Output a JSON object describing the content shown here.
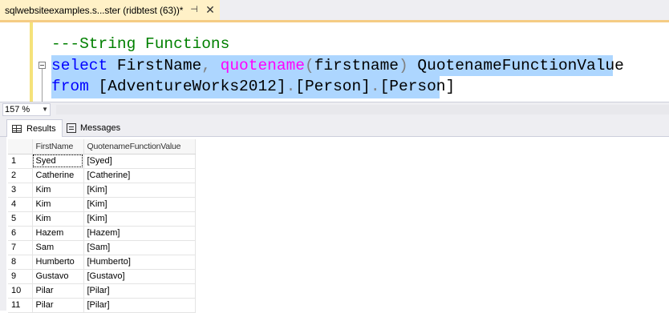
{
  "tab": {
    "title": "sqlwebsiteexamples.s...ster (ridbtest (63))*",
    "pin_icon": "pin-icon",
    "close_icon": "close-icon"
  },
  "editor": {
    "lines": {
      "comment": "---String Functions",
      "line2": {
        "kw_select": "select",
        "col1": " FirstName",
        "comma": ",",
        "fn": " quotename",
        "lparen": "(",
        "arg": "firstname",
        "rparen": ")",
        "alias": " QuotenameFunctionValue"
      },
      "line3": {
        "kw_from": "from",
        "db": " [AdventureWorks2012]",
        "dot1": ".",
        "schema": "[Person]",
        "dot2": ".",
        "table": "[Person]"
      }
    }
  },
  "zoom": {
    "value": "157 %"
  },
  "result_tabs": {
    "results_label": "Results",
    "messages_label": "Messages"
  },
  "grid": {
    "headers": [
      "FirstName",
      "QuotenameFunctionValue"
    ],
    "rows": [
      {
        "n": "1",
        "first": "Syed",
        "quoted": "[Syed]"
      },
      {
        "n": "2",
        "first": "Catherine",
        "quoted": "[Catherine]"
      },
      {
        "n": "3",
        "first": "Kim",
        "quoted": "[Kim]"
      },
      {
        "n": "4",
        "first": "Kim",
        "quoted": "[Kim]"
      },
      {
        "n": "5",
        "first": "Kim",
        "quoted": "[Kim]"
      },
      {
        "n": "6",
        "first": "Hazem",
        "quoted": "[Hazem]"
      },
      {
        "n": "7",
        "first": "Sam",
        "quoted": "[Sam]"
      },
      {
        "n": "8",
        "first": "Humberto",
        "quoted": "[Humberto]"
      },
      {
        "n": "9",
        "first": "Gustavo",
        "quoted": "[Gustavo]"
      },
      {
        "n": "10",
        "first": "Pilar",
        "quoted": "[Pilar]"
      },
      {
        "n": "11",
        "first": "Pilar",
        "quoted": "[Pilar]"
      }
    ]
  }
}
